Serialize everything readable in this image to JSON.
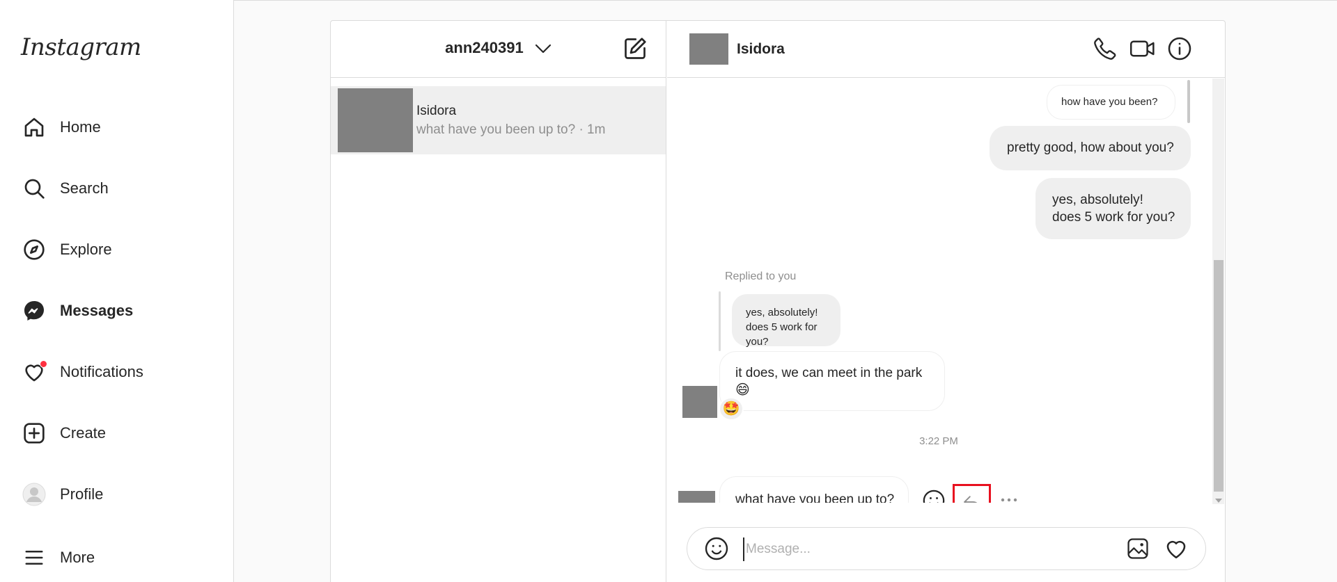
{
  "app": {
    "logo_text": "Instagram"
  },
  "nav": {
    "items": [
      {
        "label": "Home",
        "icon": "home-icon"
      },
      {
        "label": "Search",
        "icon": "search-icon"
      },
      {
        "label": "Explore",
        "icon": "compass-icon"
      },
      {
        "label": "Messages",
        "icon": "messenger-icon",
        "active": true
      },
      {
        "label": "Notifications",
        "icon": "heart-icon",
        "badge": "dot"
      },
      {
        "label": "Create",
        "icon": "plus-square-icon"
      },
      {
        "label": "Profile",
        "icon": "avatar-icon"
      },
      {
        "label": "More",
        "icon": "menu-icon"
      }
    ]
  },
  "inbox": {
    "account": "ann240391",
    "threads": [
      {
        "name": "Isidora",
        "preview": "what have you been up to? · 1m"
      }
    ]
  },
  "chat": {
    "contact_name": "Isidora",
    "header_icons": [
      "phone-icon",
      "video-icon",
      "info-icon"
    ],
    "messages": {
      "out_1": "how have you been?",
      "out_2": "pretty good, how about you?",
      "out_3_line1": "yes, absolutely!",
      "out_3_line2": "does 5 work for you?",
      "replied_label": "Replied to you",
      "quoted_line1": "yes, absolutely!",
      "quoted_line2": "does 5 work for you?",
      "in_1_text": "it does, we can meet in the park",
      "in_1_emoji": "😄",
      "in_1_reaction": "🤩",
      "timestamp": "3:22 PM",
      "in_2_text": "what have you been up to?"
    },
    "hover_actions": [
      "react-icon",
      "reply-icon",
      "more-options-icon"
    ],
    "composer": {
      "placeholder": "Message...",
      "value": ""
    }
  },
  "colors": {
    "accent_red": "#ff3040",
    "highlight_border": "#e8101f",
    "avatar_placeholder": "#808080"
  }
}
